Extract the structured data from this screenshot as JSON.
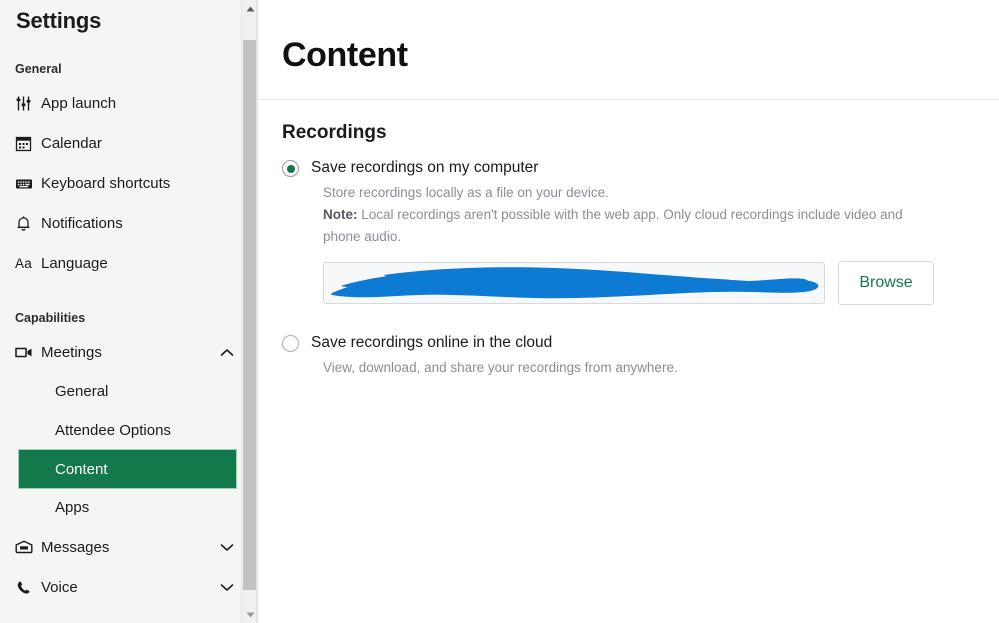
{
  "sidebar": {
    "title": "Settings",
    "sections": [
      {
        "label": "General",
        "items": [
          {
            "label": "App launch",
            "icon": "sliders-icon"
          },
          {
            "label": "Calendar",
            "icon": "calendar-icon"
          },
          {
            "label": "Keyboard shortcuts",
            "icon": "keyboard-icon"
          },
          {
            "label": "Notifications",
            "icon": "bell-icon"
          },
          {
            "label": "Language",
            "icon": "language-aa-icon"
          }
        ]
      },
      {
        "label": "Capabilities",
        "items": [
          {
            "label": "Meetings",
            "icon": "video-camera-icon",
            "expanded": true,
            "chevron": "chevron-up-icon",
            "children": [
              {
                "label": "General",
                "active": false
              },
              {
                "label": "Attendee Options",
                "active": false
              },
              {
                "label": "Content",
                "active": true
              },
              {
                "label": "Apps",
                "active": false
              }
            ]
          },
          {
            "label": "Messages",
            "icon": "inbox-icon",
            "expanded": false,
            "chevron": "chevron-down-icon",
            "children": []
          },
          {
            "label": "Voice",
            "icon": "phone-icon",
            "expanded": false,
            "chevron": "chevron-down-icon",
            "children": []
          }
        ]
      }
    ]
  },
  "main": {
    "page_title": "Content",
    "section_title": "Recordings",
    "options": [
      {
        "label": "Save recordings on my computer",
        "selected": true,
        "desc_line1": "Store recordings locally as a file on your device.",
        "note_label": "Note:",
        "note_text": " Local recordings aren't possible with the web app. Only cloud recordings include video and phone audio."
      },
      {
        "label": "Save recordings online in the cloud",
        "selected": false,
        "desc_line1": "View, download, and share your recordings from anywhere."
      }
    ],
    "path_field": {
      "value": "",
      "placeholder": "",
      "redacted": true
    },
    "browse_label": "Browse"
  },
  "colors": {
    "accent_green": "#14794a",
    "redaction_blue": "#0d7ad4",
    "sidebar_bg": "#f5f5f5",
    "muted_text": "#8a8f96"
  }
}
